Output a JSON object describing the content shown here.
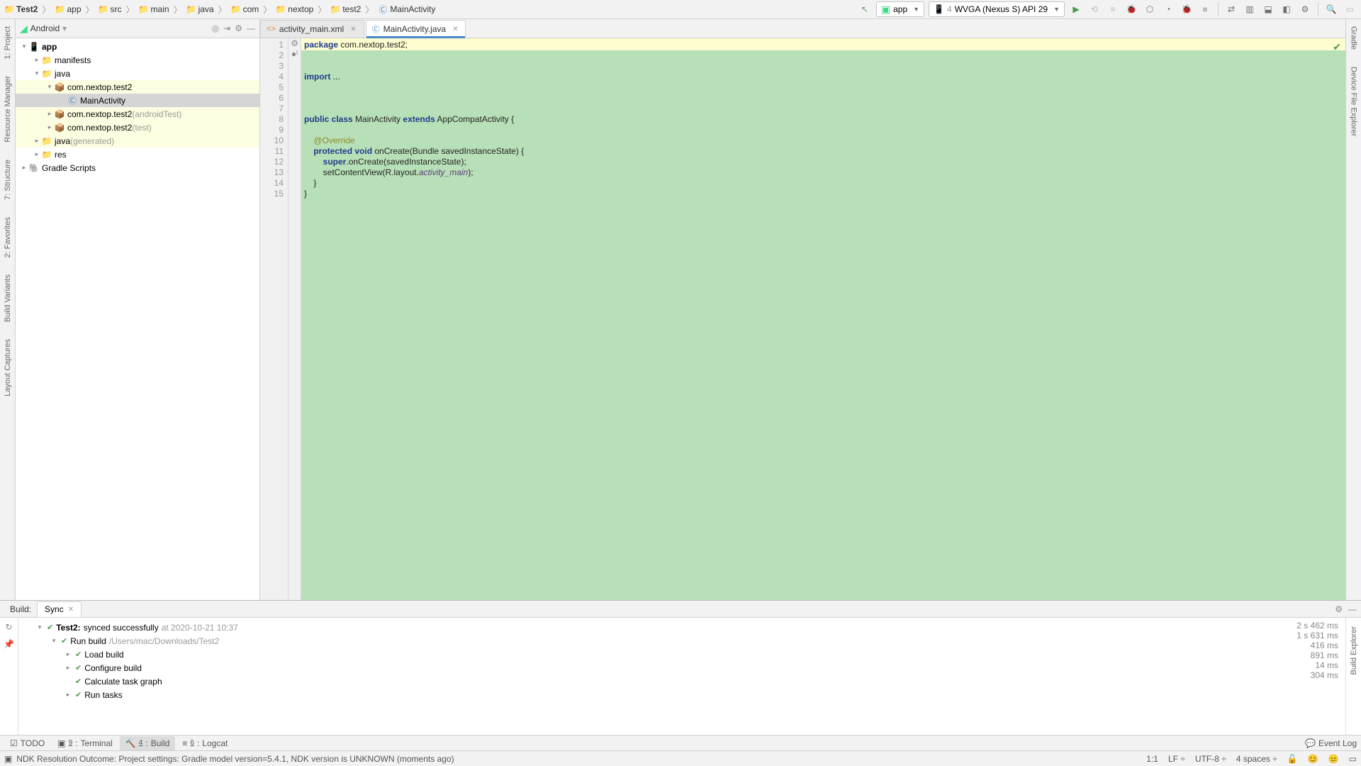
{
  "breadcrumb": [
    "Test2",
    "app",
    "src",
    "main",
    "java",
    "com",
    "nextop",
    "test2",
    "MainActivity"
  ],
  "breadcrumb_last_kind": "class",
  "runconfig_app": "app",
  "runconfig_device": "WVGA (Nexus S) API 29",
  "runconfig_device_prefix": "4",
  "project": {
    "view": "Android",
    "dropdown": "▾",
    "items": [
      {
        "depth": 0,
        "arrow": "▾",
        "icon": "📱",
        "label": "app",
        "bold": true
      },
      {
        "depth": 1,
        "arrow": "▸",
        "icon": "📁",
        "label": "manifests"
      },
      {
        "depth": 1,
        "arrow": "▾",
        "icon": "📁",
        "label": "java"
      },
      {
        "depth": 2,
        "arrow": "▾",
        "icon": "📦",
        "label": "com.nextop.test2",
        "hl": "yellow"
      },
      {
        "depth": 3,
        "arrow": "",
        "icon": "Ⓒ",
        "label": "MainActivity",
        "selected": true
      },
      {
        "depth": 2,
        "arrow": "▸",
        "icon": "📦",
        "label": "com.nextop.test2",
        "suffix": "(androidTest)",
        "hl": "yellow"
      },
      {
        "depth": 2,
        "arrow": "▸",
        "icon": "📦",
        "label": "com.nextop.test2",
        "suffix": "(test)",
        "hl": "yellow"
      },
      {
        "depth": 1,
        "arrow": "▸",
        "icon": "📁",
        "label": "java",
        "suffix": "(generated)",
        "hl": "yellow"
      },
      {
        "depth": 1,
        "arrow": "▸",
        "icon": "📁",
        "label": "res"
      },
      {
        "depth": 0,
        "arrow": "▸",
        "icon": "🐘",
        "label": "Gradle Scripts"
      }
    ]
  },
  "tabs": [
    {
      "icon": "xml",
      "label": "activity_main.xml"
    },
    {
      "icon": "class",
      "label": "MainActivity.java",
      "active": true
    }
  ],
  "code": {
    "lines": [
      "1",
      "2",
      "3",
      "4",
      "5",
      "6",
      "7",
      "8",
      "9",
      "10",
      "11",
      "12",
      "13",
      "14",
      "15"
    ],
    "gutter_marks": {
      "7": "⚙",
      "10": "●ᴵ"
    },
    "l1_kw": "package",
    "l1_rest": " com.nextop.test2;",
    "l3_kw": "import",
    "l3_rest": " ...",
    "l7_a": "public class",
    "l7_b": " MainActivity ",
    "l7_c": "extends",
    "l7_d": " AppCompatActivity {",
    "l9": "@Override",
    "l10_a": "protected void",
    "l10_b": " onCreate(Bundle savedInstanceState) {",
    "l11_a": "super",
    "l11_b": ".onCreate(savedInstanceState);",
    "l12_a": "        setContentView(R.layout.",
    "l12_b": "activity_main",
    "l12_c": ");",
    "l13": "    }",
    "l14": "}"
  },
  "build": {
    "header_label": "Build:",
    "sync_tab": "Sync",
    "root": {
      "title": "Test2:",
      "status": "synced successfully",
      "time_label": "at 2020-10-21 10:37",
      "dur": "2 s 462 ms"
    },
    "rows": [
      {
        "arrow": "▾",
        "label": "Run build",
        "suffix": "/Users/mac/Downloads/Test2",
        "dur": "1 s 631 ms"
      },
      {
        "arrow": "▸",
        "label": "Load build",
        "dur": "416 ms"
      },
      {
        "arrow": "▸",
        "label": "Configure build",
        "dur": "891 ms"
      },
      {
        "arrow": "",
        "label": "Calculate task graph",
        "dur": "14 ms"
      },
      {
        "arrow": "▸",
        "label": "Run tasks",
        "dur": "304 ms"
      }
    ]
  },
  "bottom_tabs": {
    "todo": "TODO",
    "terminal": "Terminal",
    "build": "Build",
    "logcat": "Logcat",
    "terminal_u": "9",
    "build_u": "4",
    "logcat_u": "6",
    "event_log": "Event Log"
  },
  "left_rail": [
    "1: Project",
    "Resource Manager",
    "7: Structure",
    "2: Favorites",
    "Build Variants",
    "Layout Captures"
  ],
  "right_rail": [
    "Gradle",
    "Device File Explorer"
  ],
  "build_right_rail": "Build Explorer",
  "status": {
    "msg": "NDK Resolution Outcome: Project settings: Gradle model version=5.4.1, NDK version is UNKNOWN (moments ago)",
    "pos": "1:1",
    "le": "LF",
    "enc": "UTF-8",
    "indent": "4 spaces"
  }
}
